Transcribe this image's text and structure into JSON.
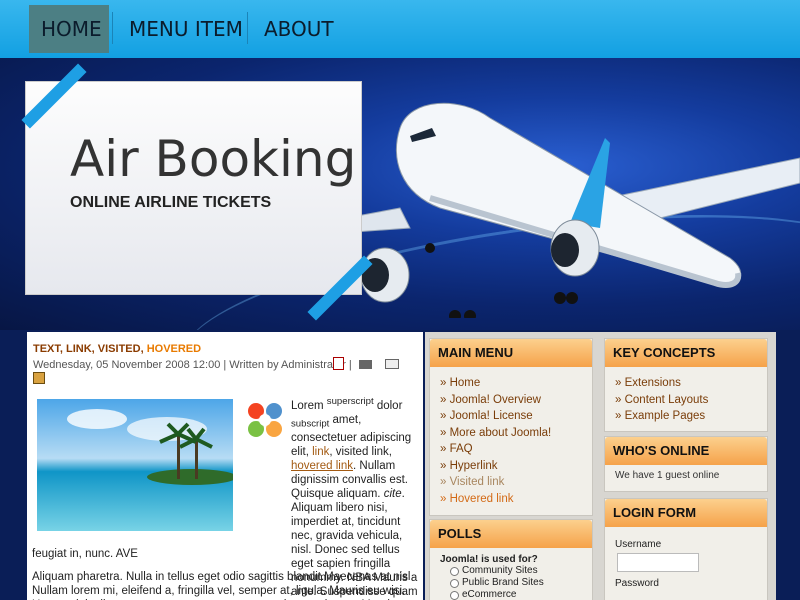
{
  "nav": {
    "items": [
      {
        "label": "HOME"
      },
      {
        "label": "MENU ITEM"
      },
      {
        "label": "ABOUT"
      }
    ]
  },
  "header": {
    "title": "Air Booking",
    "subtitle": "ONLINE AIRLINE TICKETS"
  },
  "article": {
    "title_part1": "TEXT, LINK, VISITED, ",
    "title_hovered": "HOVERED",
    "meta": "Wednesday, 05 November 2008 12:00 | Written by Administrator |",
    "text_lorem": "Lorem ",
    "text_sup": "superscript",
    "text_dolor": " dolor ",
    "text_sub": "subscript",
    "text_amet": " amet, consectetuer adipiscing elit, ",
    "link": "link",
    "text_visited": ", visited link, ",
    "hovered_link": "hovered link",
    "text_rest": ". Nullam dignissim convallis est. Quisque aliquam. ",
    "cite": "cite",
    "text_rest2": ". Aliquam libero nisi, imperdiet at, tincidunt nec, gravida vehicula, nisl. Donec sed tellus eget sapien fringilla nonummy. NBA Mauris a ante. Suspendisse quam sem, consequat at, commodo vitae,",
    "text_cont": "feugiat in, nunc. AVE",
    "para2": "Aliquam pharetra. Nulla in tellus eget odio sagittis blandit.Maecenas at nisl. Nullam lorem mi, eleifend a, fringilla vel, semper at, ligula. Mauris eu wisi. Ut ante dui, aliquet nec, congue non, accumsan sit amet, lectus. Mauris et"
  },
  "main_menu": {
    "title": "MAIN MENU",
    "items": [
      {
        "label": "Home",
        "state": "normal"
      },
      {
        "label": "Joomla! Overview",
        "state": "normal"
      },
      {
        "label": "Joomla! License",
        "state": "normal"
      },
      {
        "label": "More about Joomla!",
        "state": "normal"
      },
      {
        "label": "FAQ",
        "state": "normal"
      },
      {
        "label": "Hyperlink",
        "state": "normal"
      },
      {
        "label": "Visited link",
        "state": "visited"
      },
      {
        "label": "Hovered link",
        "state": "hovered"
      }
    ]
  },
  "polls": {
    "title": "POLLS",
    "question": "Joomla! is used for?",
    "options": [
      "Community Sites",
      "Public Brand Sites",
      "eCommerce"
    ]
  },
  "key_concepts": {
    "title": "KEY CONCEPTS",
    "items": [
      "Extensions",
      "Content Layouts",
      "Example Pages"
    ]
  },
  "whos_online": {
    "title": "WHO'S ONLINE",
    "text": "We have 1 guest online"
  },
  "login": {
    "title": "LOGIN FORM",
    "username_label": "Username",
    "password_label": "Password"
  },
  "colors": {
    "nav_bg": "#1ea4e4",
    "module_header": "#f5a24a",
    "link": "#7a3d09"
  }
}
